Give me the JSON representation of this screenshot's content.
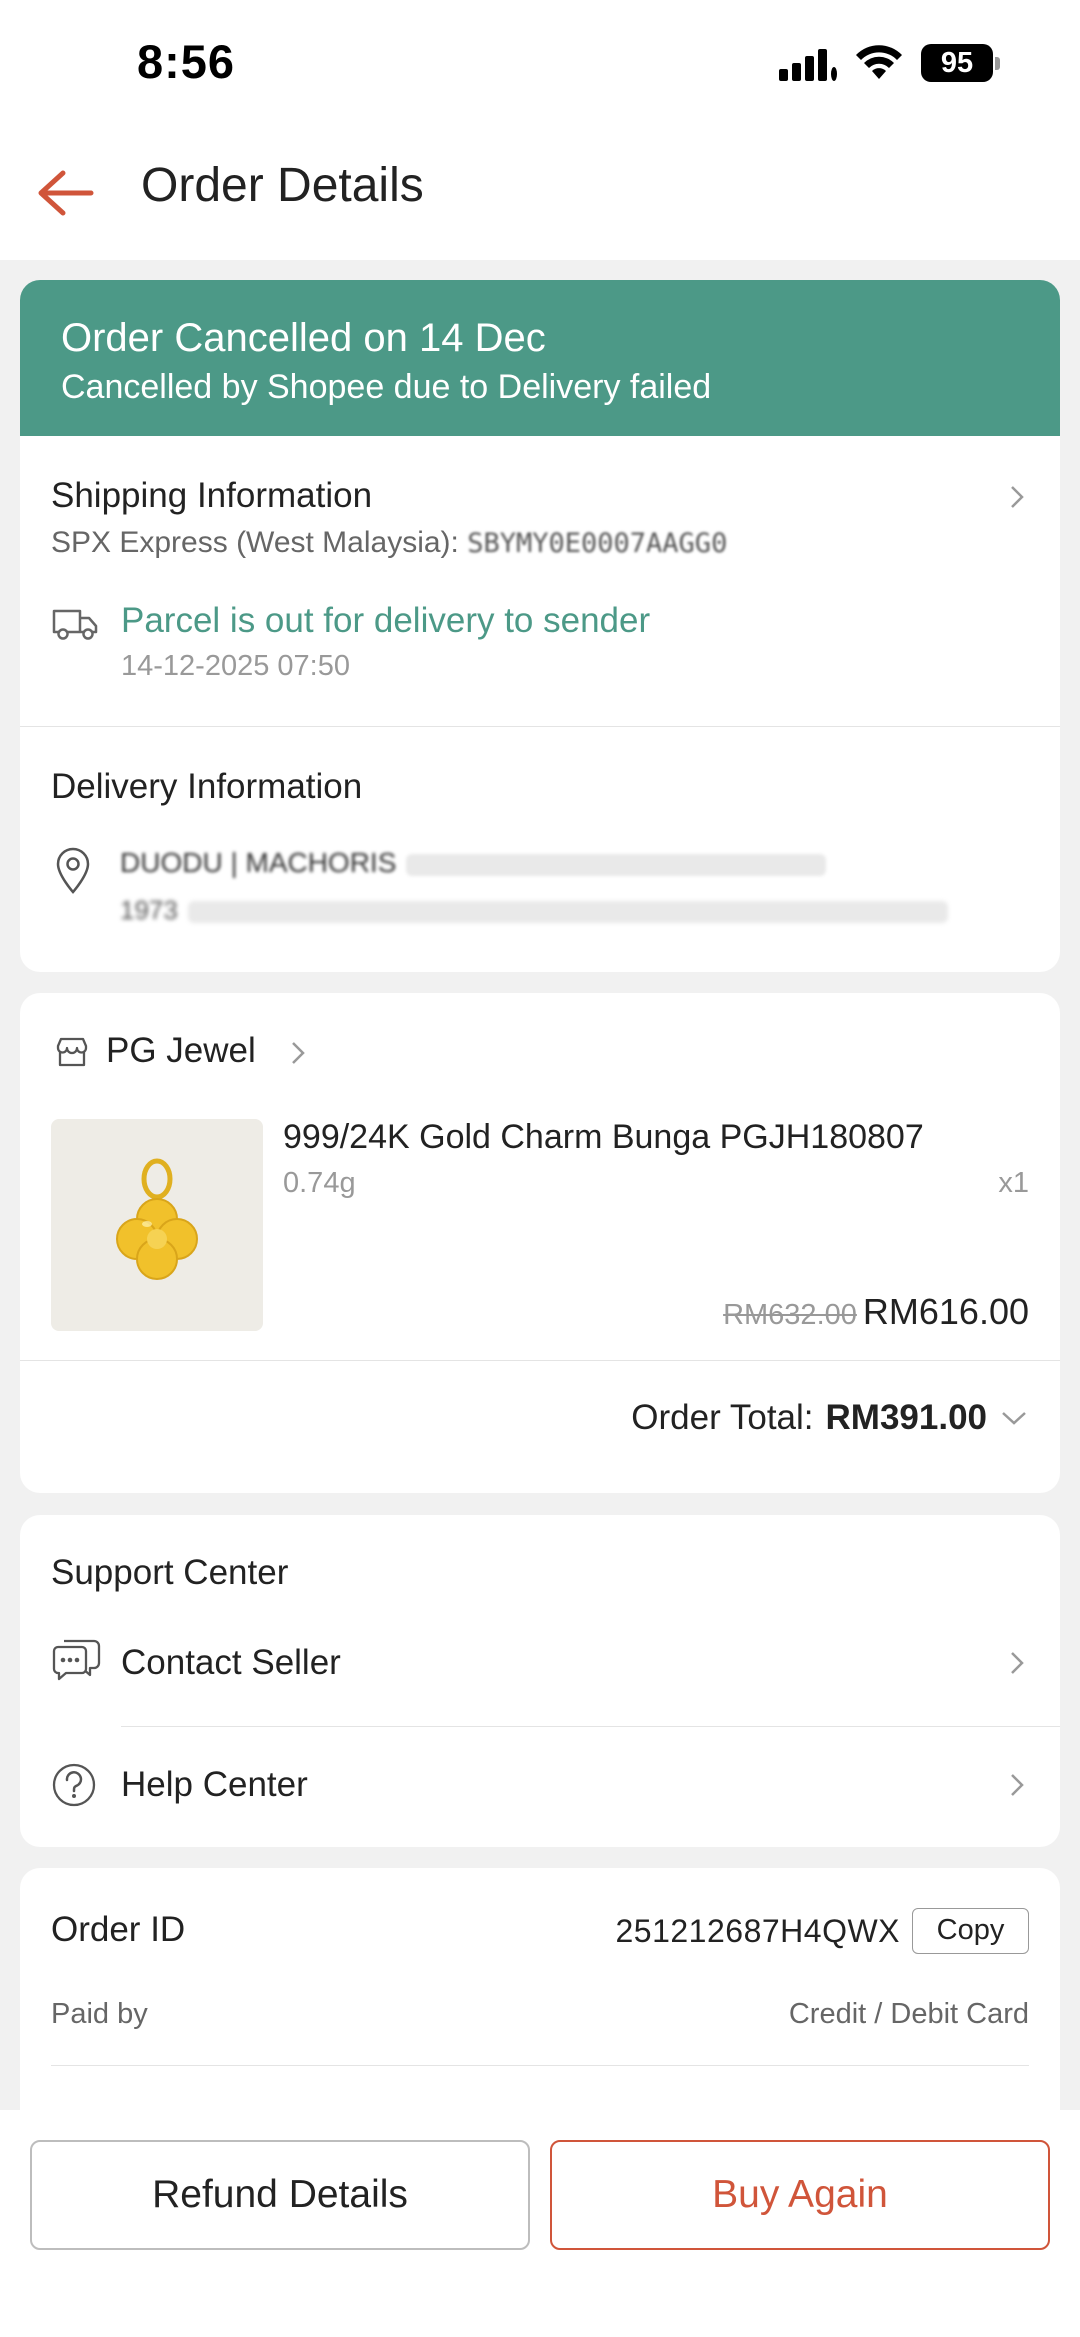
{
  "status_bar": {
    "time": "8:56",
    "battery": "95"
  },
  "header": {
    "title": "Order Details",
    "back_icon": "arrow-left-icon"
  },
  "banner": {
    "title": "Order Cancelled on 14 Dec",
    "subtitle": "Cancelled by Shopee due to Delivery failed",
    "color": "#4c9987"
  },
  "shipping": {
    "title": "Shipping Information",
    "courier": "SPX Express (West Malaysia):",
    "tracking": "SBYMY0E0007AAGG0",
    "status": "Parcel is out for delivery to sender",
    "time": "14-12-2025 07:50"
  },
  "delivery": {
    "title": "Delivery Information",
    "address_line1": "DUODU | MACHORIS",
    "address_line2": "1973"
  },
  "product": {
    "shop_name": "PG Jewel",
    "name": "999/24K Gold Charm Bunga PGJH180807",
    "variation": "0.74g",
    "quantity": "x1",
    "original_price": "RM632.00",
    "price": "RM616.00",
    "order_total_label": "Order Total:",
    "order_total": "RM391.00"
  },
  "support": {
    "title": "Support Center",
    "items": [
      {
        "label": "Contact Seller",
        "icon": "chat-icon"
      },
      {
        "label": "Help Center",
        "icon": "question-icon"
      }
    ]
  },
  "order_info": {
    "order_id_label": "Order ID",
    "order_id": "251212687H4QWX",
    "copy_label": "Copy",
    "paid_by_label": "Paid by",
    "paid_by": "Credit / Debit Card"
  },
  "actions": {
    "refund_label": "Refund Details",
    "buy_again_label": "Buy Again",
    "accent": "#d0553a"
  }
}
